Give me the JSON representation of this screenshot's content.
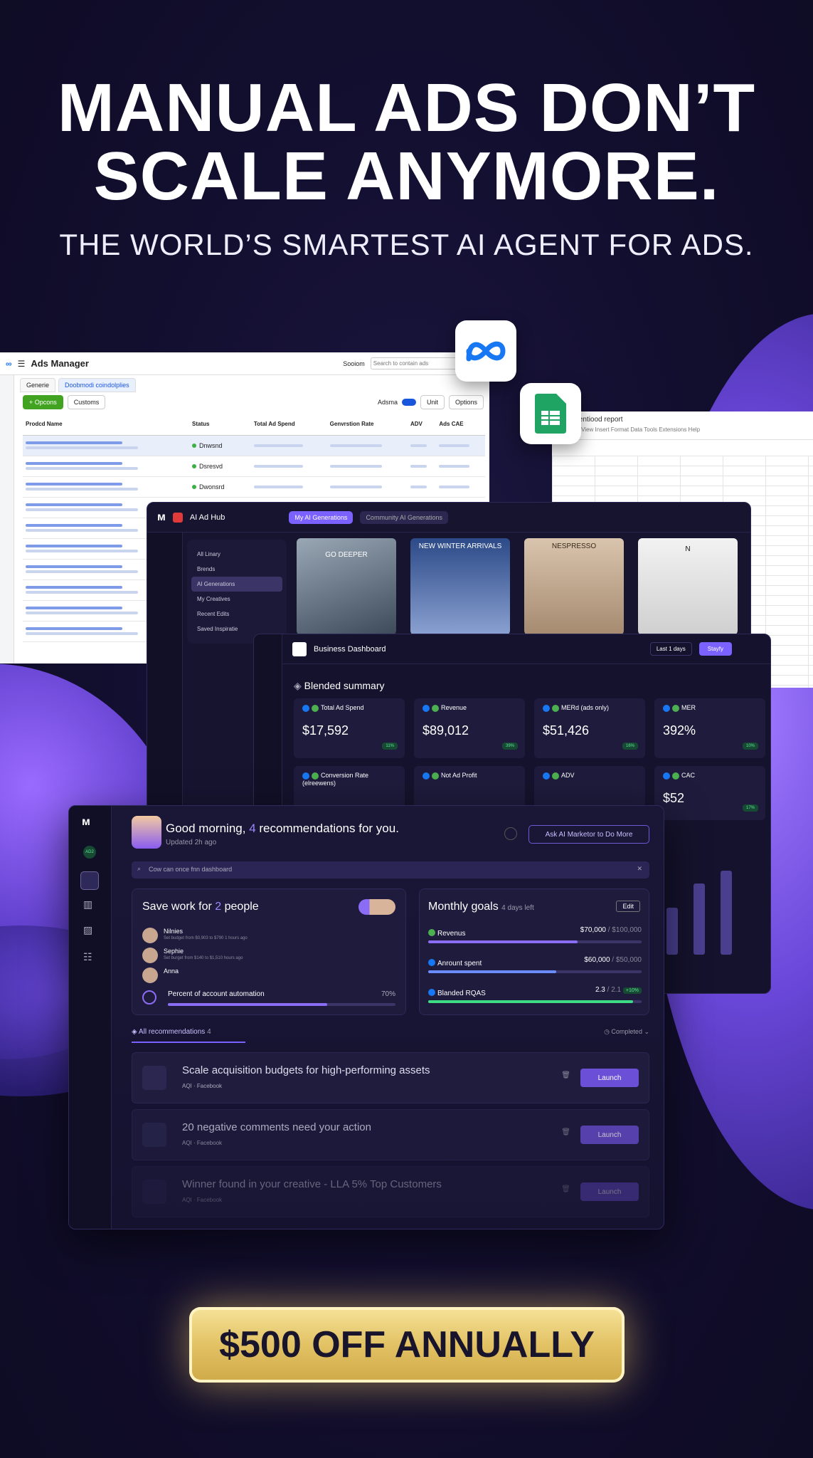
{
  "headline": {
    "line1": "MANUAL ADS DON’T",
    "line2": "SCALE ANYMORE.",
    "subline": "THE WORLD’S SMARTEST AI AGENT FOR ADS."
  },
  "ads_manager": {
    "title": "Ads Manager",
    "search_placeholder": "Search to contain ads",
    "header_extra": "Sooiom",
    "tabs": [
      "Generie",
      "Doobmodi coindolplies"
    ],
    "toolbar": [
      "+ Opcons",
      "Customs",
      "Adsma",
      "Unit",
      "Options"
    ],
    "columns": [
      "Prodcd Name",
      "Status",
      "Total Ad Spend",
      "Genvrstion Rate",
      "ADV",
      "Ads CAE"
    ],
    "status": [
      "Dnwsnd",
      "Dsresvd",
      "Dwonsrd"
    ],
    "row_count": 10
  },
  "spreadsheet": {
    "title": "Scoocentiood report",
    "menu": "File  Edit  View  Insert  Format  Data  Tools  Extensions  Help"
  },
  "ai_hub": {
    "title": "AI Ad Hub",
    "tab_active": "My AI Generations",
    "tab_inactive": "Community AI Generations",
    "menu": [
      "All Linary",
      "Brends",
      "AI Generations",
      "My Creatives",
      "Recent Edits",
      "Saved Inspiratie"
    ],
    "thumbs": [
      "GO DEEPER",
      "NEW WINTER ARRIVALS",
      "NESPRESSO",
      "N"
    ]
  },
  "business": {
    "title": "Business Dashboard",
    "range": "Last 1 days",
    "share": "Stayfy",
    "section": "Blended summary",
    "cards": [
      {
        "label": "Total Ad Spend",
        "value": "$17,592",
        "chip": "11%"
      },
      {
        "label": "Revenue",
        "value": "$89,012",
        "chip": "39%"
      },
      {
        "label": "MERd (ads only)",
        "value": "$51,426",
        "chip": "16%"
      },
      {
        "label": "MER",
        "value": "392%",
        "chip": "10%"
      },
      {
        "label": "Conversion Rate (elreewens)",
        "value": "",
        "chip": ""
      },
      {
        "label": "Not Ad Profit",
        "value": "",
        "chip": ""
      },
      {
        "label": "ADV",
        "value": "",
        "chip": ""
      },
      {
        "label": "CAC",
        "value": "$52",
        "chip": "17%"
      }
    ]
  },
  "main": {
    "greeting_pre": "Good morning, ",
    "greeting_num": "4",
    "greeting_post": " recommendations for you.",
    "updated": "Updated 2h ago",
    "ask_btn": "Ask AI Marketor to Do More",
    "search_placeholder": "Cow can once fnn dashboard",
    "avatar_badge": "AD2",
    "save": {
      "title_pre": "Save work for ",
      "title_num": "2",
      "title_post": " people",
      "people": [
        {
          "name": "Nilnies",
          "note": "Set budget from $0,903 to $790 1 hours ago"
        },
        {
          "name": "Sephie",
          "note": "Set burget from $140 to $1,510 hours ago"
        },
        {
          "name": "Anna",
          "note": ""
        }
      ],
      "automation_label": "Percent of account automation",
      "automation_pct": "70%",
      "automation_value": 0.7
    },
    "goals": {
      "title": "Monthly goals",
      "days": "4 days left",
      "edit": "Edit",
      "items": [
        {
          "label": "Revenus",
          "value": "$70,000",
          "target": " / $100,000",
          "progress": 0.7
        },
        {
          "label": "Anrount spent",
          "value": "$60,000",
          "target": " / $50,000",
          "progress": 0.6
        },
        {
          "label": "Blanded RQAS",
          "value": "2.3",
          "target": " / 2.1",
          "chip": "+10%",
          "progress": 0.96
        }
      ]
    },
    "recs_tab": "All recommendations",
    "recs_count": "4",
    "completed": "Completed",
    "recs": [
      {
        "title": "Scale acquisition budgets for high-performing assets",
        "tag1": "AQI",
        "tag2": "Facebook",
        "action": "Launch"
      },
      {
        "title": "20 negative comments need your action",
        "tag1": "AQI",
        "tag2": "Facebook",
        "action": "Launch"
      },
      {
        "title": "Winner found in your creative - LLA 5% Top Customers",
        "tag1": "AQI",
        "tag2": "Facebook",
        "action": "Launch"
      }
    ]
  },
  "cta": "$500 OFF ANNUALLY",
  "colors": {
    "accent": "#7b61ff",
    "gold": "#e2c264",
    "positive": "#5fe39b"
  }
}
